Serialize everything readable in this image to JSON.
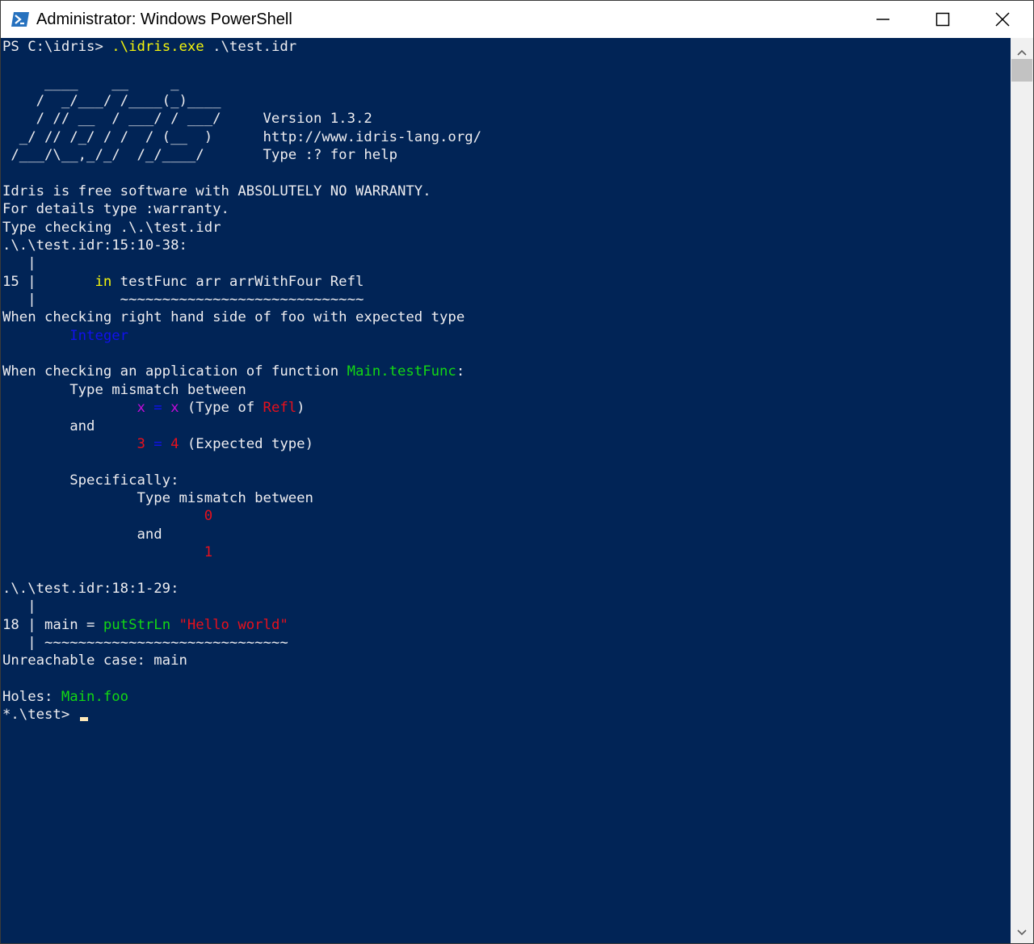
{
  "window": {
    "title": "Administrator: Windows PowerShell",
    "colors": {
      "background": "#012456",
      "foreground": "#eeedf0",
      "yellow": "#f4f40c",
      "green": "#13d713",
      "blue": "#1111ee",
      "magenta": "#c40bd9",
      "red": "#e8101c"
    }
  },
  "console": {
    "lines": [
      [
        {
          "t": "PS C:\\idris> "
        },
        {
          "t": ".\\idris.exe",
          "c": "yellow"
        },
        {
          "t": " .\\test.idr"
        }
      ],
      [
        {
          "t": ""
        }
      ],
      [
        {
          "t": "     ____    __     _"
        }
      ],
      [
        {
          "t": "    /  _/___/ /____(_)____"
        }
      ],
      [
        {
          "t": "    / // __  / ___/ / ___/     Version 1.3.2"
        }
      ],
      [
        {
          "t": "  _/ // /_/ / /  / (__  )      http://www.idris-lang.org/"
        }
      ],
      [
        {
          "t": " /___/\\__,_/_/  /_/____/       Type :? for help"
        }
      ],
      [
        {
          "t": ""
        }
      ],
      [
        {
          "t": "Idris is free software with ABSOLUTELY NO WARRANTY."
        }
      ],
      [
        {
          "t": "For details type :warranty."
        }
      ],
      [
        {
          "t": "Type checking .\\.\\test.idr"
        }
      ],
      [
        {
          "t": ".\\.\\test.idr:15:10-38:"
        }
      ],
      [
        {
          "t": "   |"
        }
      ],
      [
        {
          "t": "15 |       "
        },
        {
          "t": "in",
          "c": "yellow"
        },
        {
          "t": " testFunc arr arrWithFour Refl"
        }
      ],
      [
        {
          "t": "   |          ~~~~~~~~~~~~~~~~~~~~~~~~~~~~~"
        }
      ],
      [
        {
          "t": "When checking right hand side of foo with expected type"
        }
      ],
      [
        {
          "t": "        "
        },
        {
          "t": "Integer",
          "c": "blue"
        }
      ],
      [
        {
          "t": ""
        }
      ],
      [
        {
          "t": "When checking an application of function "
        },
        {
          "t": "Main.testFunc",
          "c": "green"
        },
        {
          "t": ":"
        }
      ],
      [
        {
          "t": "        Type mismatch between"
        }
      ],
      [
        {
          "t": "                "
        },
        {
          "t": "x",
          "c": "magenta"
        },
        {
          "t": " "
        },
        {
          "t": "=",
          "c": "blue"
        },
        {
          "t": " "
        },
        {
          "t": "x",
          "c": "magenta"
        },
        {
          "t": " (Type of "
        },
        {
          "t": "Refl",
          "c": "red"
        },
        {
          "t": ")"
        }
      ],
      [
        {
          "t": "        and"
        }
      ],
      [
        {
          "t": "                "
        },
        {
          "t": "3",
          "c": "red"
        },
        {
          "t": " "
        },
        {
          "t": "=",
          "c": "blue"
        },
        {
          "t": " "
        },
        {
          "t": "4",
          "c": "red"
        },
        {
          "t": " (Expected type)"
        }
      ],
      [
        {
          "t": ""
        }
      ],
      [
        {
          "t": "        Specifically:"
        }
      ],
      [
        {
          "t": "                Type mismatch between"
        }
      ],
      [
        {
          "t": "                        "
        },
        {
          "t": "0",
          "c": "red"
        }
      ],
      [
        {
          "t": "                and"
        }
      ],
      [
        {
          "t": "                        "
        },
        {
          "t": "1",
          "c": "red"
        }
      ],
      [
        {
          "t": ""
        }
      ],
      [
        {
          "t": ".\\.\\test.idr:18:1-29:"
        }
      ],
      [
        {
          "t": "   |"
        }
      ],
      [
        {
          "t": "18 | main = "
        },
        {
          "t": "putStrLn",
          "c": "green"
        },
        {
          "t": " "
        },
        {
          "t": "\"Hello world\"",
          "c": "red"
        }
      ],
      [
        {
          "t": "   | ~~~~~~~~~~~~~~~~~~~~~~~~~~~~~"
        }
      ],
      [
        {
          "t": "Unreachable case: main"
        }
      ],
      [
        {
          "t": ""
        }
      ],
      [
        {
          "t": "Holes: "
        },
        {
          "t": "Main.foo",
          "c": "green"
        }
      ],
      [
        {
          "t": "*.\\test> "
        },
        {
          "cursor": true
        }
      ]
    ]
  }
}
